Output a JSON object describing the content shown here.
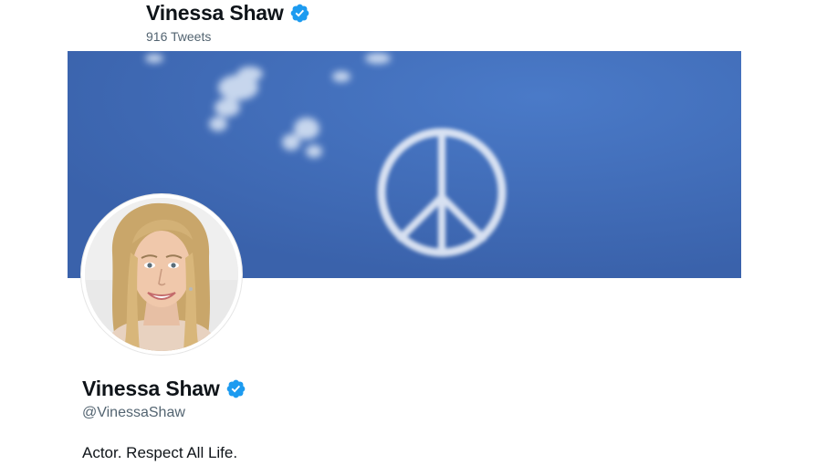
{
  "header": {
    "name": "Vinessa Shaw",
    "tweet_count": "916 Tweets",
    "verified_icon": "verified-badge-icon"
  },
  "banner": {
    "description_icon": "peace-sign-skywriting",
    "sky_color": "#3d6ab6"
  },
  "profile": {
    "avatar_icon": "profile-photo",
    "display_name": "Vinessa Shaw",
    "handle": "@VinessaShaw",
    "bio": "Actor. Respect All Life.",
    "verified_icon": "verified-badge-icon"
  },
  "colors": {
    "verified_blue": "#1d9bf0",
    "secondary_text": "#536471",
    "primary_text": "#0f1419"
  }
}
